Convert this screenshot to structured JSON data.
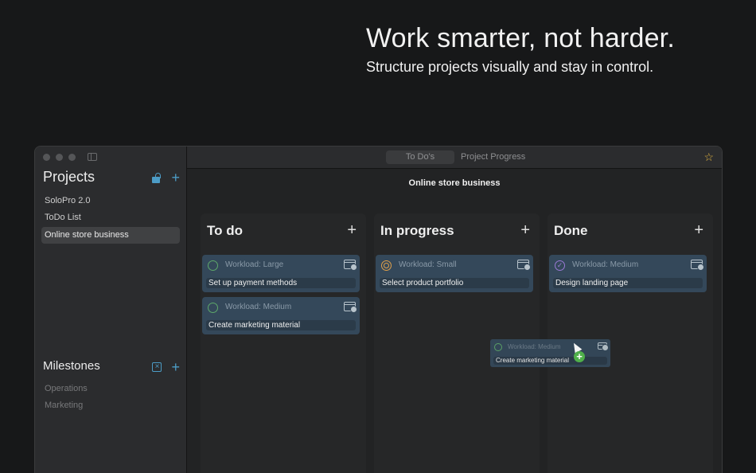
{
  "hero": {
    "title": "Work smarter, not harder.",
    "subtitle": "Structure projects visually and stay in control."
  },
  "sidebar": {
    "projects_title": "Projects",
    "projects": [
      {
        "label": "SoloPro 2.0",
        "active": false
      },
      {
        "label": "ToDo List",
        "active": false
      },
      {
        "label": "Online store business",
        "active": true
      }
    ],
    "milestones_title": "Milestones",
    "milestones": [
      {
        "label": "Operations"
      },
      {
        "label": "Marketing"
      }
    ]
  },
  "toolbar": {
    "tabs": [
      {
        "label": "To Do's",
        "active": true
      },
      {
        "label": "Project Progress",
        "active": false
      }
    ],
    "star_icon": "star-icon"
  },
  "board": {
    "title": "Online store business",
    "columns": [
      {
        "title": "To do",
        "cards": [
          {
            "workload": "Workload: Large",
            "title": "Set up payment methods",
            "status": "open"
          },
          {
            "workload": "Workload: Medium",
            "title": "Create marketing material",
            "status": "open"
          }
        ]
      },
      {
        "title": "In progress",
        "cards": [
          {
            "workload": "Workload: Small",
            "title": "Select product portfolio",
            "status": "in-progress"
          }
        ]
      },
      {
        "title": "Done",
        "cards": [
          {
            "workload": "Workload: Medium",
            "title": "Design landing page",
            "status": "done"
          }
        ]
      }
    ],
    "dragging_card": {
      "workload": "Workload: Medium",
      "title": "Create marketing material"
    }
  },
  "colors": {
    "accent": "#4c9cc6",
    "card_bg": "#34485a",
    "star": "#e0b341",
    "add_badge": "#4fb04a"
  }
}
